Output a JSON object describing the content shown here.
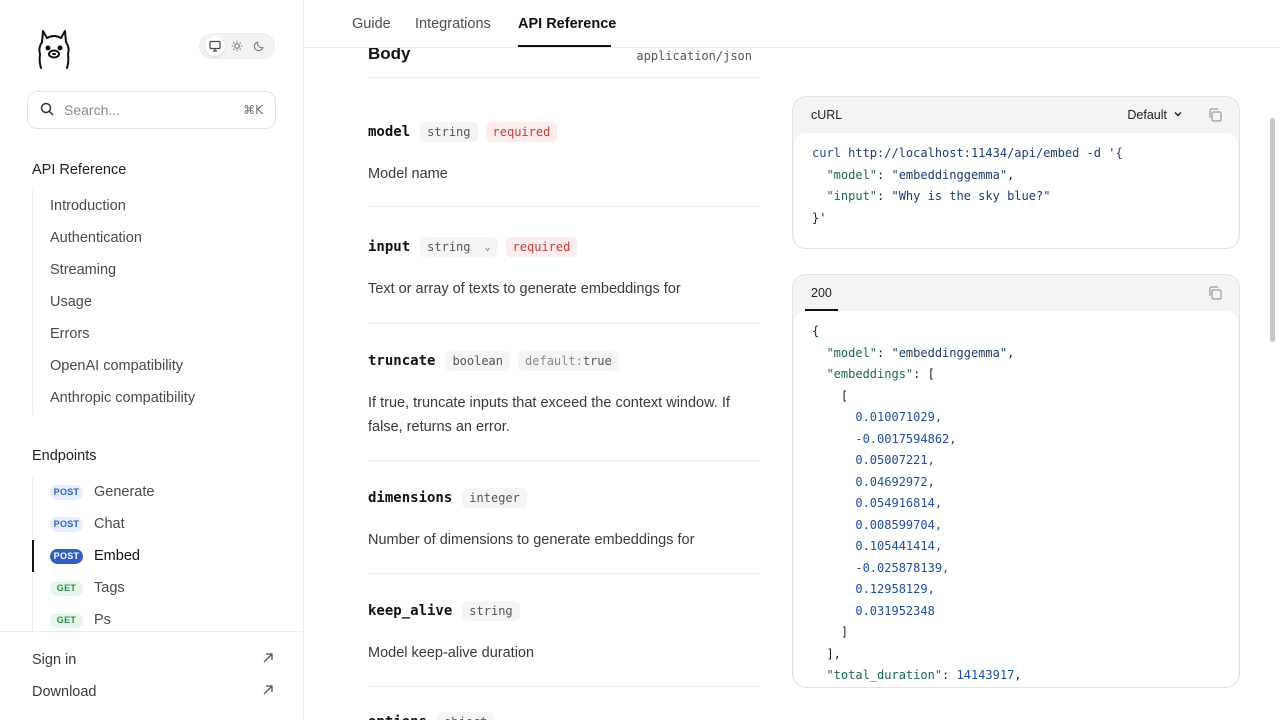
{
  "header": {
    "tabs": [
      {
        "label": "Guide"
      },
      {
        "label": "Integrations"
      },
      {
        "label": "API Reference"
      }
    ]
  },
  "search": {
    "placeholder": "Search...",
    "shortcut": "⌘K"
  },
  "sidebar": {
    "sections": [
      {
        "title": "API Reference",
        "items": [
          "Introduction",
          "Authentication",
          "Streaming",
          "Usage",
          "Errors",
          "OpenAI compatibility",
          "Anthropic compatibility"
        ]
      },
      {
        "title": "Endpoints",
        "items": [
          {
            "method": "POST",
            "label": "Generate"
          },
          {
            "method": "POST",
            "label": "Chat"
          },
          {
            "method": "POST",
            "label": "Embed"
          },
          {
            "method": "GET",
            "label": "Tags"
          },
          {
            "method": "GET",
            "label": "Ps"
          }
        ]
      }
    ],
    "active_item": "Embed",
    "footer": [
      {
        "label": "Sign in"
      },
      {
        "label": "Download"
      }
    ]
  },
  "body": {
    "title": "Body",
    "content_type": "application/json",
    "params": [
      {
        "name": "model",
        "type": "string",
        "required": "required",
        "description": "Model name"
      },
      {
        "name": "input",
        "type": "string",
        "required": "required",
        "description": "Text or array of texts to generate embeddings for"
      },
      {
        "name": "truncate",
        "type": "boolean",
        "default_key": "default:",
        "default_val": "true",
        "description_1": "If true, truncate inputs that exceed the context window. If",
        "description_2": "false, returns an error."
      },
      {
        "name": "dimensions",
        "type": "integer",
        "description": "Number of dimensions to generate embeddings for"
      },
      {
        "name": "keep_alive",
        "type": "string",
        "description": "Model keep-alive duration"
      },
      {
        "name": "options",
        "type": "object"
      }
    ]
  },
  "request_panel": {
    "title": "cURL",
    "selector": "Default",
    "lines": {
      "cmd": "curl",
      "url": " http://localhost:11434/api/embed -d '{",
      "k1": "\"model\"",
      "v1": "\"embeddinggemma\"",
      "k2": "\"input\"",
      "v2": "\"Why is the sky blue?\"",
      "end": "}'"
    }
  },
  "response_panel": {
    "status": "200",
    "values": [
      "0.010071029,",
      "-0.0017594862,",
      "0.05007221,",
      "0.04692972,",
      "0.054916814,",
      "0.008599704,",
      "0.105441414,",
      "-0.025878139,",
      "0.12958129,",
      "0.031952348"
    ],
    "k_model": "\"model\"",
    "v_model": "\"embeddinggemma\"",
    "k_emb": "\"embeddings\"",
    "k_total": "\"total_duration\"",
    "v_total": "14143917"
  },
  "colors": {
    "post": "#2f5fc4",
    "get": "#2f8a4a",
    "required": "#c04040"
  }
}
